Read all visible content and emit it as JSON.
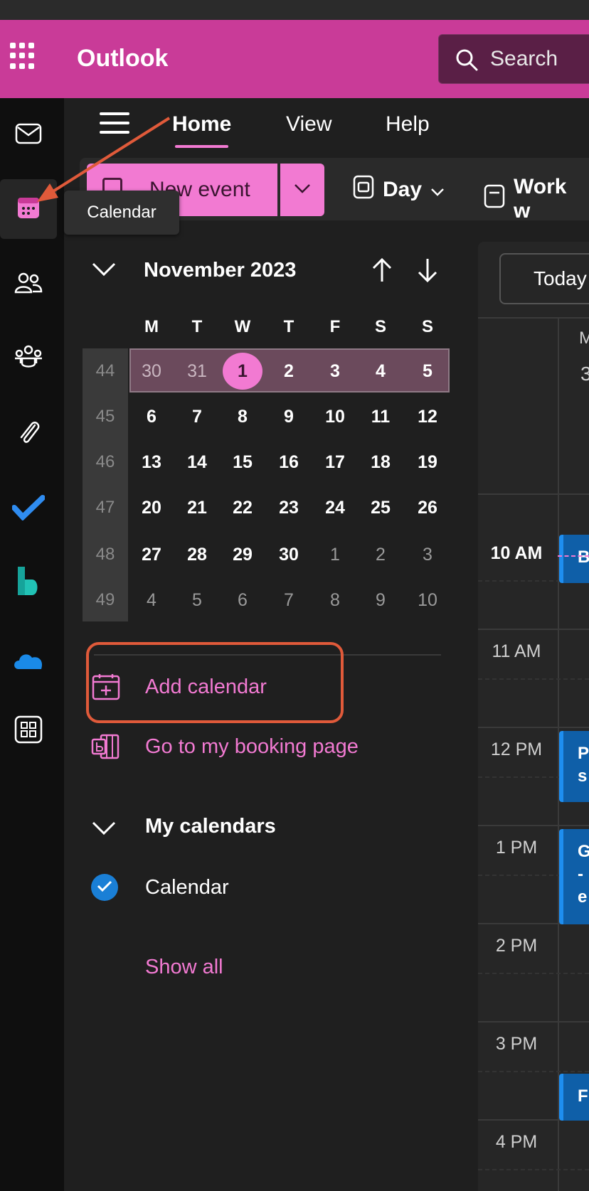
{
  "app": {
    "title": "Outlook"
  },
  "search": {
    "placeholder": "Search"
  },
  "rail": {
    "items": [
      {
        "name": "mail",
        "icon": "mail-icon"
      },
      {
        "name": "calendar",
        "icon": "calendar-icon",
        "active": true
      },
      {
        "name": "people",
        "icon": "people-icon"
      },
      {
        "name": "groups",
        "icon": "groups-icon"
      },
      {
        "name": "files",
        "icon": "paperclip-icon"
      },
      {
        "name": "todo",
        "icon": "todo-check-icon"
      },
      {
        "name": "bookings",
        "icon": "bookings-icon"
      },
      {
        "name": "onedrive",
        "icon": "onedrive-icon"
      },
      {
        "name": "more-apps",
        "icon": "apps-icon"
      }
    ]
  },
  "tooltip": {
    "text": "Calendar"
  },
  "menu": {
    "tabs": [
      "Home",
      "View",
      "Help"
    ],
    "active_tab": "Home"
  },
  "toolbar": {
    "new_event": "New event",
    "day": "Day",
    "work_week": "Work w"
  },
  "mini_calendar": {
    "month_label": "November 2023",
    "weekdays": [
      "M",
      "T",
      "W",
      "T",
      "F",
      "S",
      "S"
    ],
    "weeks": [
      {
        "number": "44",
        "days": [
          "30",
          "31",
          "1",
          "2",
          "3",
          "4",
          "5"
        ]
      },
      {
        "number": "45",
        "days": [
          "6",
          "7",
          "8",
          "9",
          "10",
          "11",
          "12"
        ]
      },
      {
        "number": "46",
        "days": [
          "13",
          "14",
          "15",
          "16",
          "17",
          "18",
          "19"
        ]
      },
      {
        "number": "47",
        "days": [
          "20",
          "21",
          "22",
          "23",
          "24",
          "25",
          "26"
        ]
      },
      {
        "number": "48",
        "days": [
          "27",
          "28",
          "29",
          "30",
          "1",
          "2",
          "3"
        ]
      },
      {
        "number": "49",
        "days": [
          "4",
          "5",
          "6",
          "7",
          "8",
          "9",
          "10"
        ]
      }
    ],
    "today": "1"
  },
  "links": {
    "add_calendar": "Add calendar",
    "booking_page": "Go to my booking page",
    "show_all": "Show all"
  },
  "my_calendars": {
    "heading": "My calendars",
    "items": [
      {
        "label": "Calendar",
        "checked": true
      }
    ]
  },
  "day_view": {
    "today_button": "Today",
    "day_letter": "M",
    "day_number": "3",
    "hours": [
      "10 AM",
      "11 AM",
      "12 PM",
      "1 PM",
      "2 PM",
      "3 PM",
      "4 PM"
    ],
    "events": [
      {
        "lines": [
          "B"
        ]
      },
      {
        "lines": [
          "P",
          "s"
        ]
      },
      {
        "lines": [
          "G",
          "-",
          "e"
        ]
      },
      {
        "lines": [
          "F"
        ]
      }
    ]
  },
  "colors": {
    "brand": "#c93b98",
    "accent": "#f27ad2",
    "annotation": "#e05a3a",
    "event": "#0f5fa8"
  }
}
